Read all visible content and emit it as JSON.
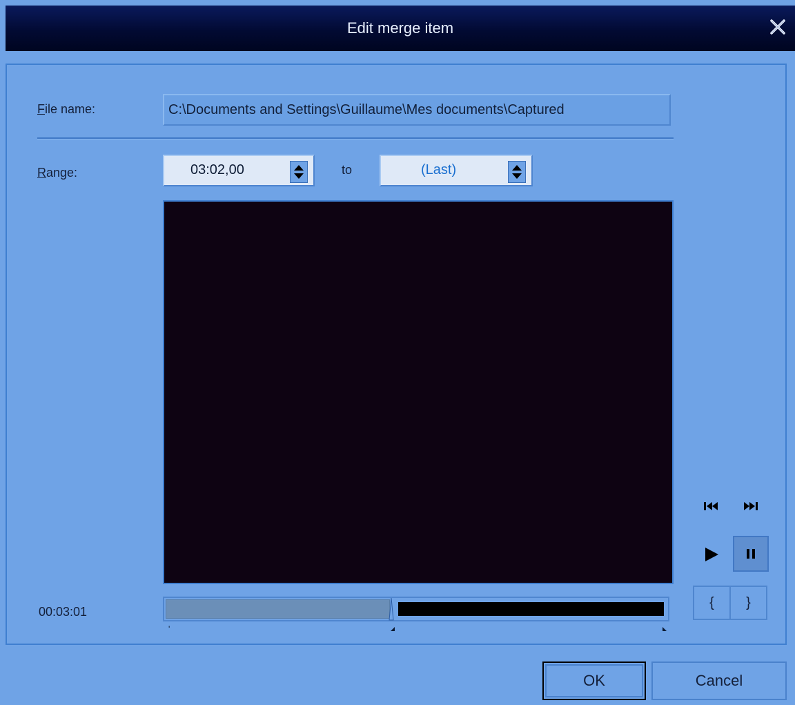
{
  "window": {
    "title": "Edit merge item",
    "close_icon": "close-icon"
  },
  "file": {
    "label": "File name:",
    "accelerator": "F",
    "label_rest": "ile name:",
    "path": "C:\\Documents and Settings\\Guillaume\\Mes documents\\Captured"
  },
  "range": {
    "label": "Range:",
    "accelerator": "R",
    "label_rest": "ange:",
    "start": "03:02,00",
    "to_label": "to",
    "end": "(Last)"
  },
  "playback": {
    "current_time": "00:03:01",
    "progress": 0.45
  },
  "controls": {
    "open_bracket": "{",
    "close_bracket": "}"
  },
  "buttons": {
    "ok": "OK",
    "cancel": "Cancel"
  },
  "colors": {
    "accent": "#6fa3e6",
    "title_bar": "#020a33",
    "video_bg": "#0e0312",
    "link_text": "#1a6fd0"
  }
}
